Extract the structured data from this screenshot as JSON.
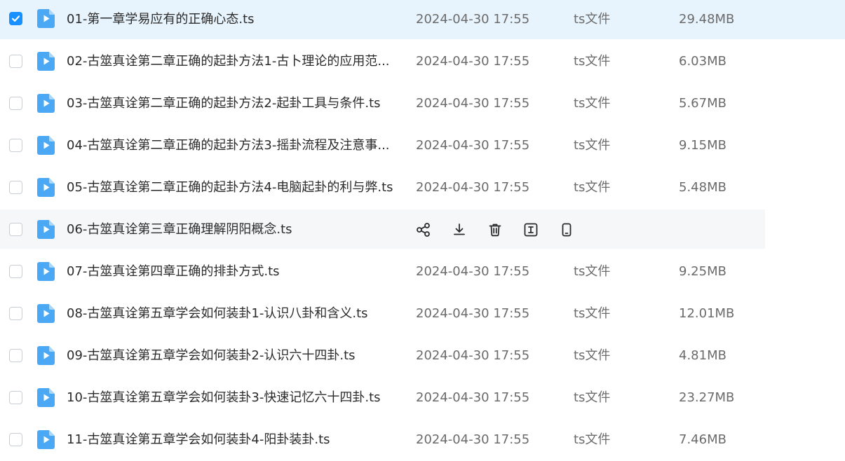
{
  "colors": {
    "accent": "#1890ff",
    "selected_row_bg": "#e8f4fd",
    "hover_row_bg": "#f6f7f9",
    "file_icon": "#4aa8f5"
  },
  "files": [
    {
      "name": "01-第一章学易应有的正确心态.ts",
      "date": "2024-04-30 17:55",
      "type": "ts文件",
      "size": "29.48MB",
      "checked": true
    },
    {
      "name": "02-古筮真诠第二章正确的起卦方法1-古卜理论的应用范...",
      "date": "2024-04-30 17:55",
      "type": "ts文件",
      "size": "6.03MB",
      "checked": false
    },
    {
      "name": "03-古筮真诠第二章正确的起卦方法2-起卦工具与条件.ts",
      "date": "2024-04-30 17:55",
      "type": "ts文件",
      "size": "5.67MB",
      "checked": false
    },
    {
      "name": "04-古筮真诠第二章正确的起卦方法3-摇卦流程及注意事...",
      "date": "2024-04-30 17:55",
      "type": "ts文件",
      "size": "9.15MB",
      "checked": false
    },
    {
      "name": "05-古筮真诠第二章正确的起卦方法4-电脑起卦的利与弊.ts",
      "date": "2024-04-30 17:55",
      "type": "ts文件",
      "size": "5.48MB",
      "checked": false
    },
    {
      "name": "06-古筮真诠第三章正确理解阴阳概念.ts",
      "date": "",
      "type": "",
      "size": "",
      "checked": false,
      "hovered": true
    },
    {
      "name": "07-古筮真诠第四章正确的排卦方式.ts",
      "date": "2024-04-30 17:55",
      "type": "ts文件",
      "size": "9.25MB",
      "checked": false
    },
    {
      "name": "08-古筮真诠第五章学会如何装卦1-认识八卦和含义.ts",
      "date": "2024-04-30 17:55",
      "type": "ts文件",
      "size": "12.01MB",
      "checked": false
    },
    {
      "name": "09-古筮真诠第五章学会如何装卦2-认识六十四卦.ts",
      "date": "2024-04-30 17:55",
      "type": "ts文件",
      "size": "4.81MB",
      "checked": false
    },
    {
      "name": "10-古筮真诠第五章学会如何装卦3-快速记忆六十四卦.ts",
      "date": "2024-04-30 17:55",
      "type": "ts文件",
      "size": "23.27MB",
      "checked": false
    },
    {
      "name": "11-古筮真诠第五章学会如何装卦4-阳卦装卦.ts",
      "date": "2024-04-30 17:55",
      "type": "ts文件",
      "size": "7.46MB",
      "checked": false
    }
  ],
  "hover_actions": [
    {
      "icon": "share-icon"
    },
    {
      "icon": "download-icon"
    },
    {
      "icon": "delete-icon"
    },
    {
      "icon": "rename-icon"
    },
    {
      "icon": "phone-icon"
    }
  ]
}
